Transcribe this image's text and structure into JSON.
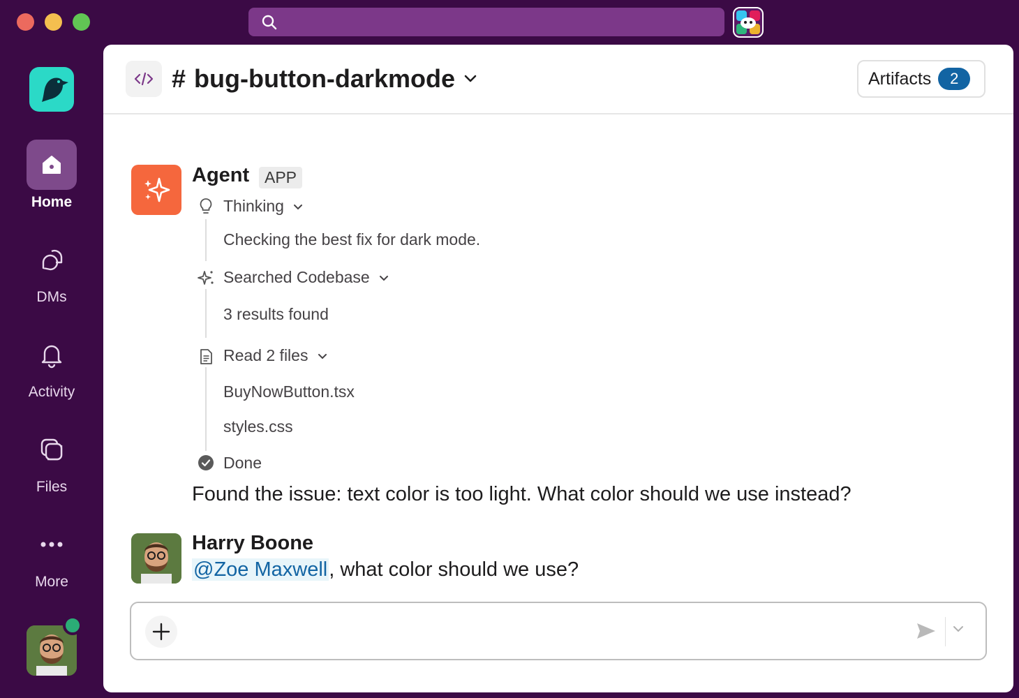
{
  "titlebar": {
    "search_placeholder": ""
  },
  "sidebar": {
    "items": [
      {
        "label": "Home",
        "icon": "home-icon",
        "active": true
      },
      {
        "label": "DMs",
        "icon": "dms-icon"
      },
      {
        "label": "Activity",
        "icon": "bell-icon"
      },
      {
        "label": "Files",
        "icon": "files-icon"
      },
      {
        "label": "More",
        "icon": "more-icon"
      }
    ]
  },
  "header": {
    "hash": "#",
    "channel_name": "bug-button-darkmode",
    "artifacts_label": "Artifacts",
    "artifacts_count": "2"
  },
  "messages": {
    "agent": {
      "sender": "Agent",
      "tag": "APP",
      "steps": {
        "thinking": "Thinking",
        "thinking_detail": "Checking the best fix for dark mode.",
        "searched": "Searched Codebase",
        "searched_detail": "3 results found",
        "read": "Read 2 files",
        "file1": "BuyNowButton.tsx",
        "file2": "styles.css",
        "done": "Done"
      },
      "final": "Found the issue: text color is too light. What color should we use instead?"
    },
    "harry": {
      "sender": "Harry Boone",
      "mention": "@Zoe Maxwell",
      "text": ", what color should we use?"
    }
  },
  "composer": {
    "placeholder": ""
  },
  "colors": {
    "sidebar_bg": "#3b0a45",
    "search_bg": "#7c3889",
    "agent_avatar": "#f5673d",
    "logo": "#2bd9c7",
    "badge": "#1264a3",
    "presence": "#2bac76"
  }
}
